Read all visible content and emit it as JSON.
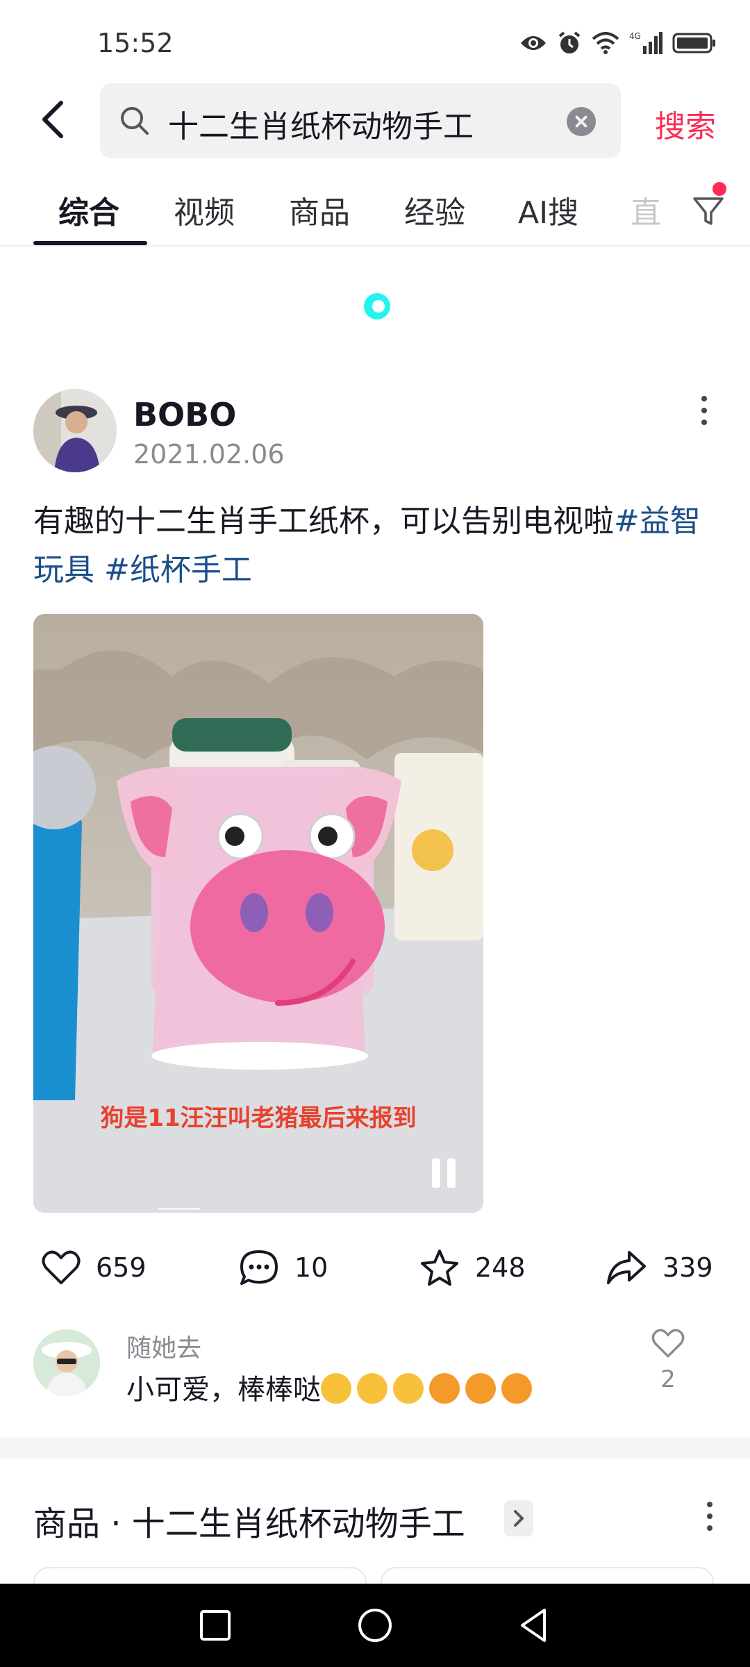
{
  "status_bar": {
    "time": "15:52",
    "network": "4G",
    "icons": [
      "eye-icon",
      "alarm-icon",
      "wifi-icon",
      "signal-icon",
      "battery-icon"
    ]
  },
  "search": {
    "query": "十二生肖纸杯动物手工",
    "submit_label": "搜索"
  },
  "tabs": [
    {
      "label": "综合",
      "active": true
    },
    {
      "label": "视频",
      "active": false
    },
    {
      "label": "商品",
      "active": false
    },
    {
      "label": "经验",
      "active": false
    },
    {
      "label": "AI搜",
      "active": false
    },
    {
      "label": "直",
      "active": false
    }
  ],
  "post": {
    "author": "BOBO",
    "date": "2021.02.06",
    "text": "有趣的十二生肖手工纸杯，可以告别电视啦",
    "hashtags": [
      "#益智玩具",
      "#纸杯手工"
    ],
    "video_caption": "狗是11汪汪叫老猪最后来报到",
    "likes": "659",
    "comments": "10",
    "favorites": "248",
    "shares": "339"
  },
  "comment": {
    "user": "随她去",
    "text": "小可爱，棒棒哒",
    "emojis": [
      "clap",
      "clap",
      "clap",
      "thumbs-up",
      "thumbs-up",
      "thumbs-up"
    ],
    "likes": "2"
  },
  "products_section": {
    "title": "商品 · 十二生肖纸杯动物手工"
  },
  "colors": {
    "accent": "#fe2c55",
    "hashtag": "#1b4f8a",
    "loader": "#25f4ee"
  }
}
